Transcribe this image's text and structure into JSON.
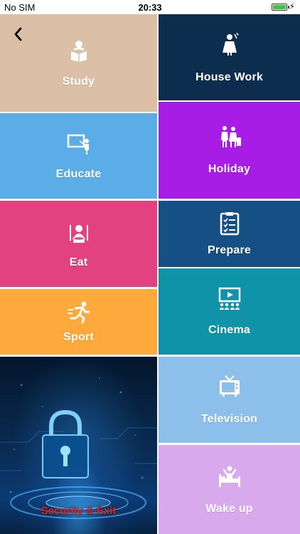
{
  "status_bar": {
    "carrier": "No SIM",
    "time": "20:33"
  },
  "tiles": {
    "study": {
      "label": "Study",
      "color": "#dcbfa7",
      "icon": "reading-person-icon"
    },
    "house_work": {
      "label": "House Work",
      "color": "#0d2d4e",
      "icon": "maid-icon"
    },
    "educate": {
      "label": "Educate",
      "color": "#5aade6",
      "icon": "teacher-board-icon"
    },
    "holiday": {
      "label": "Holiday",
      "color": "#a81de5",
      "icon": "travelers-luggage-icon"
    },
    "eat": {
      "label": "Eat",
      "color": "#e2427f",
      "icon": "dining-plate-icon"
    },
    "prepare": {
      "label": "Prepare",
      "color": "#154f83",
      "icon": "checklist-icon"
    },
    "sport": {
      "label": "Sport",
      "color": "#fda93b",
      "icon": "runner-icon"
    },
    "cinema": {
      "label": "Cinema",
      "color": "#0f93a8",
      "icon": "cinema-screen-icon"
    },
    "security": {
      "label": "Security & Exit",
      "icon": "padlock-icon"
    },
    "television": {
      "label": "Television",
      "color": "#8cc0ea",
      "icon": "tv-icon"
    },
    "wake_up": {
      "label": "Wake up",
      "color": "#d9a9ee",
      "icon": "bed-wakeup-icon"
    }
  },
  "nav": {
    "back_icon": "chevron-left-icon"
  }
}
